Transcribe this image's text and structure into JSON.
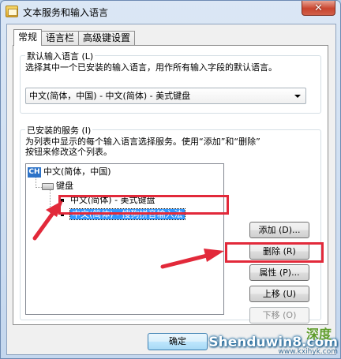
{
  "window": {
    "title": "文本服务和输入语言",
    "close_label": "✕"
  },
  "tabs": [
    {
      "label": "常规",
      "active": true
    },
    {
      "label": "语言栏",
      "active": false
    },
    {
      "label": "高级键设置",
      "active": false
    }
  ],
  "default_language": {
    "legend": "默认输入语言 (L)",
    "description": "选择其中一个已安装的输入语言，用作所有输入字段的默认语言。",
    "selected": "中文(简体，中国) - 中文(简体) - 美式键盘"
  },
  "installed_services": {
    "legend": "已安装的服务 (I)",
    "description_line1": "为列表中显示的每个输入语言选择服务。使用“添加”和“删除”",
    "description_line2": "按钮来修改这个列表。",
    "tree": {
      "language_code": "CH",
      "language": "中文(简体，中国)",
      "group": "键盘",
      "items": [
        {
          "label": "中文(简体) - 美式键盘",
          "selected": false
        },
        {
          "label": "中文(简体) - 搜狗拼音输入法",
          "selected": true
        }
      ]
    },
    "buttons": {
      "add": "添加 (D)...",
      "remove": "删除 (R)",
      "properties": "属性 (P)...",
      "move_up": "上移 (U)",
      "move_down": "下移 (O)"
    }
  },
  "dialog_buttons": {
    "ok": "确定"
  },
  "watermark": {
    "main": "Shenduwin8.com",
    "sub": "www.kxihyk.com",
    "chinese": "深度"
  },
  "colors": {
    "annotation_red": "#e2293a",
    "selection_blue": "#3399ff"
  }
}
